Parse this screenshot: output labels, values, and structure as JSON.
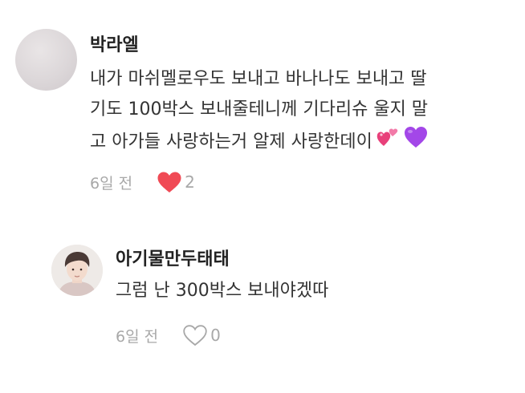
{
  "comments": [
    {
      "author": "박라엘",
      "lines": [
        "내가 마쉬멜로우도 보내고 바나나도 보내고 딸",
        "기도 100박스 보내줄테니께 기다리슈 울지 말",
        "고 아가들 사랑하는거 알제 사랑한데이"
      ],
      "emojis": [
        "two-hearts",
        "purple-heart"
      ],
      "time": "6일 전",
      "likes": "2",
      "liked": true
    },
    {
      "author": "아기물만두태태",
      "text": "그럼 난 300박스 보내야겠따",
      "time": "6일 전",
      "likes": "0",
      "liked": false
    }
  ],
  "colors": {
    "heart_filled": "#f04a55",
    "meta_text": "#a8a8a8",
    "emoji_pink": "#e8407a",
    "emoji_purple": "#a347e8"
  }
}
